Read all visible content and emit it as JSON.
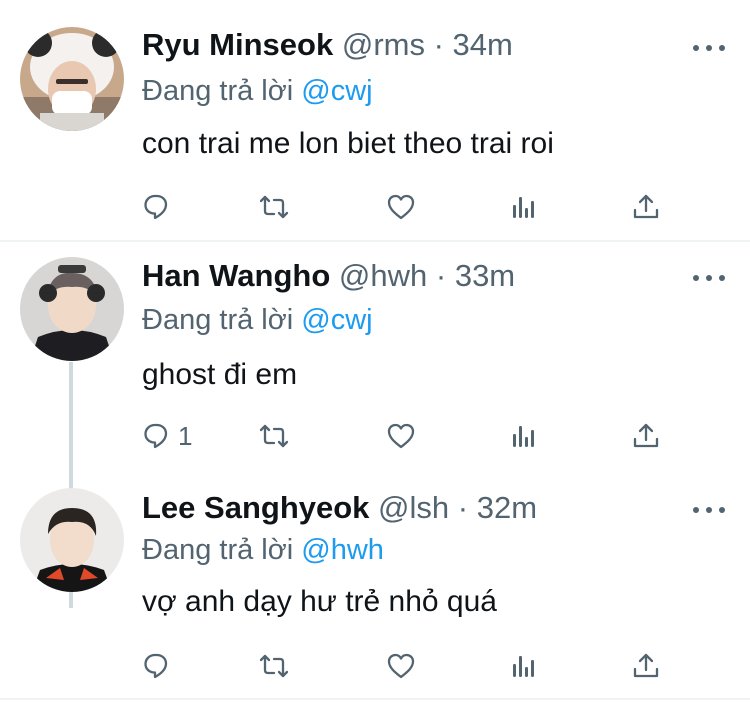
{
  "tweets": [
    {
      "name": "Ryu Minseok",
      "handle": "@rms",
      "sep": "·",
      "time": "34m",
      "reply_prefix": "Đang trả lời",
      "reply_to": "@cwj",
      "text": "con trai me lon biet theo trai roi",
      "reply_count": ""
    },
    {
      "name": "Han Wangho",
      "handle": "@hwh",
      "sep": "·",
      "time": "33m",
      "reply_prefix": "Đang trả lời",
      "reply_to": "@cwj",
      "text": "ghost đi em",
      "reply_count": "1"
    },
    {
      "name": "Lee Sanghyeok",
      "handle": "@lsh",
      "sep": "·",
      "time": "32m",
      "reply_prefix": "Đang trả lời",
      "reply_to": "@hwh",
      "text": "vợ anh dạy hư trẻ nhỏ quá",
      "reply_count": ""
    }
  ],
  "icons": {
    "reply": "reply-icon",
    "retweet": "retweet-icon",
    "like": "like-icon",
    "analytics": "analytics-icon",
    "share": "share-icon",
    "more": "more-icon"
  },
  "colors": {
    "text": "#0f1419",
    "secondary": "#536471",
    "accent": "#1d9bf0",
    "divider": "#eff3f4",
    "thread_line": "#cfd9de"
  }
}
